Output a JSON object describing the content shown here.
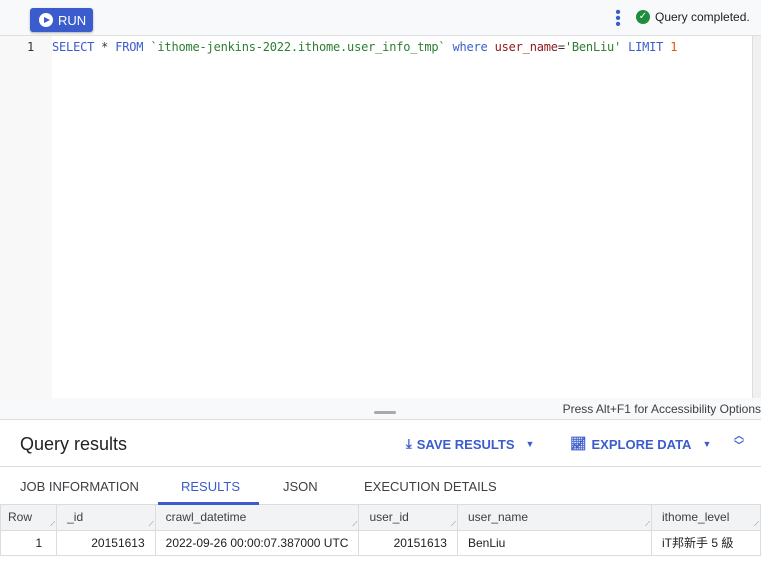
{
  "toolbar": {
    "run_label": "RUN",
    "status": "Query completed."
  },
  "editor": {
    "line_number": "1",
    "tokens": {
      "select": "SELECT",
      "star": " * ",
      "from": "FROM",
      "table": " `ithome-jenkins-2022.ithome.user_info_tmp` ",
      "where": "where",
      "col": " user_name",
      "eq": "=",
      "val": "'BenLiu'",
      "limit": " LIMIT ",
      "n": "1"
    },
    "accessibility_hint": "Press Alt+F1 for Accessibility Options"
  },
  "results": {
    "title": "Query results",
    "save_label": "SAVE RESULTS",
    "explore_label": "EXPLORE DATA",
    "tabs": [
      {
        "label": "JOB INFORMATION"
      },
      {
        "label": "RESULTS"
      },
      {
        "label": "JSON"
      },
      {
        "label": "EXECUTION DETAILS"
      }
    ],
    "columns": [
      "Row",
      "_id",
      "crawl_datetime",
      "user_id",
      "user_name",
      "ithome_level"
    ],
    "rows": [
      [
        "1",
        "20151613",
        "2022-09-26 00:00:07.387000 UTC",
        "20151613",
        "BenLiu",
        "iT邦新手 5 級"
      ]
    ]
  },
  "colors": {
    "accent": "#3b5ccc",
    "success": "#1e8e3e"
  }
}
